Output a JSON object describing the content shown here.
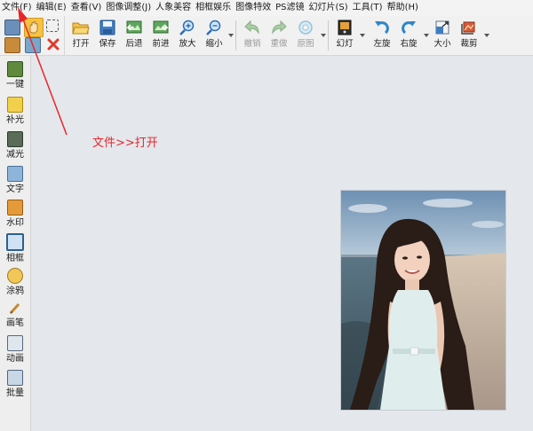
{
  "menu": [
    {
      "id": "file",
      "label": "文件(F)"
    },
    {
      "id": "edit",
      "label": "编辑(E)"
    },
    {
      "id": "view",
      "label": "查看(V)"
    },
    {
      "id": "image-adjust",
      "label": "图像调整(J)"
    },
    {
      "id": "portrait",
      "label": "人象美容"
    },
    {
      "id": "frame",
      "label": "相框娱乐"
    },
    {
      "id": "effects",
      "label": "图像特效"
    },
    {
      "id": "ps-filter",
      "label": "PS滤镜"
    },
    {
      "id": "slideshow",
      "label": "幻灯片(S)"
    },
    {
      "id": "tools",
      "label": "工具(T)"
    },
    {
      "id": "help",
      "label": "帮助(H)"
    }
  ],
  "toolbar": [
    {
      "id": "open",
      "label": "打开",
      "icon": "folder-open-icon"
    },
    {
      "id": "save",
      "label": "保存",
      "icon": "floppy-icon"
    },
    {
      "id": "back",
      "label": "后退",
      "icon": "back-image-icon"
    },
    {
      "id": "forward",
      "label": "前进",
      "icon": "forward-image-icon"
    },
    {
      "id": "zoom-in",
      "label": "放大",
      "icon": "zoom-in-icon"
    },
    {
      "id": "zoom-out",
      "label": "缩小",
      "icon": "zoom-out-icon"
    },
    {
      "id": "undo",
      "label": "撤销",
      "icon": "undo-icon",
      "disabled": true
    },
    {
      "id": "redo",
      "label": "重做",
      "icon": "redo-icon",
      "disabled": true
    },
    {
      "id": "original",
      "label": "原图",
      "icon": "original-icon",
      "disabled": true
    },
    {
      "id": "slideshow",
      "label": "幻灯",
      "icon": "slideshow-icon"
    },
    {
      "id": "rotate-left",
      "label": "左旋",
      "icon": "rotate-left-icon"
    },
    {
      "id": "rotate-right",
      "label": "右旋",
      "icon": "rotate-right-icon"
    },
    {
      "id": "resize",
      "label": "大小",
      "icon": "resize-icon"
    },
    {
      "id": "crop",
      "label": "裁剪",
      "icon": "crop-icon"
    }
  ],
  "sidebar": [
    {
      "id": "one-click",
      "label": "一键",
      "icon": "magic-icon"
    },
    {
      "id": "fill-light",
      "label": "补光",
      "icon": "fill-light-icon"
    },
    {
      "id": "reduce-light",
      "label": "减光",
      "icon": "reduce-light-icon"
    },
    {
      "id": "text",
      "label": "文字",
      "icon": "text-icon"
    },
    {
      "id": "watermark",
      "label": "水印",
      "icon": "watermark-icon"
    },
    {
      "id": "frame",
      "label": "相框",
      "icon": "frame-icon"
    },
    {
      "id": "graffiti",
      "label": "涂鸦",
      "icon": "palette-icon"
    },
    {
      "id": "brush",
      "label": "画笔",
      "icon": "brush-icon"
    },
    {
      "id": "animation",
      "label": "动画",
      "icon": "animation-icon"
    },
    {
      "id": "batch",
      "label": "批量",
      "icon": "batch-icon"
    }
  ],
  "annotation": {
    "text": "文件>>打开",
    "color": "#e8262a"
  }
}
